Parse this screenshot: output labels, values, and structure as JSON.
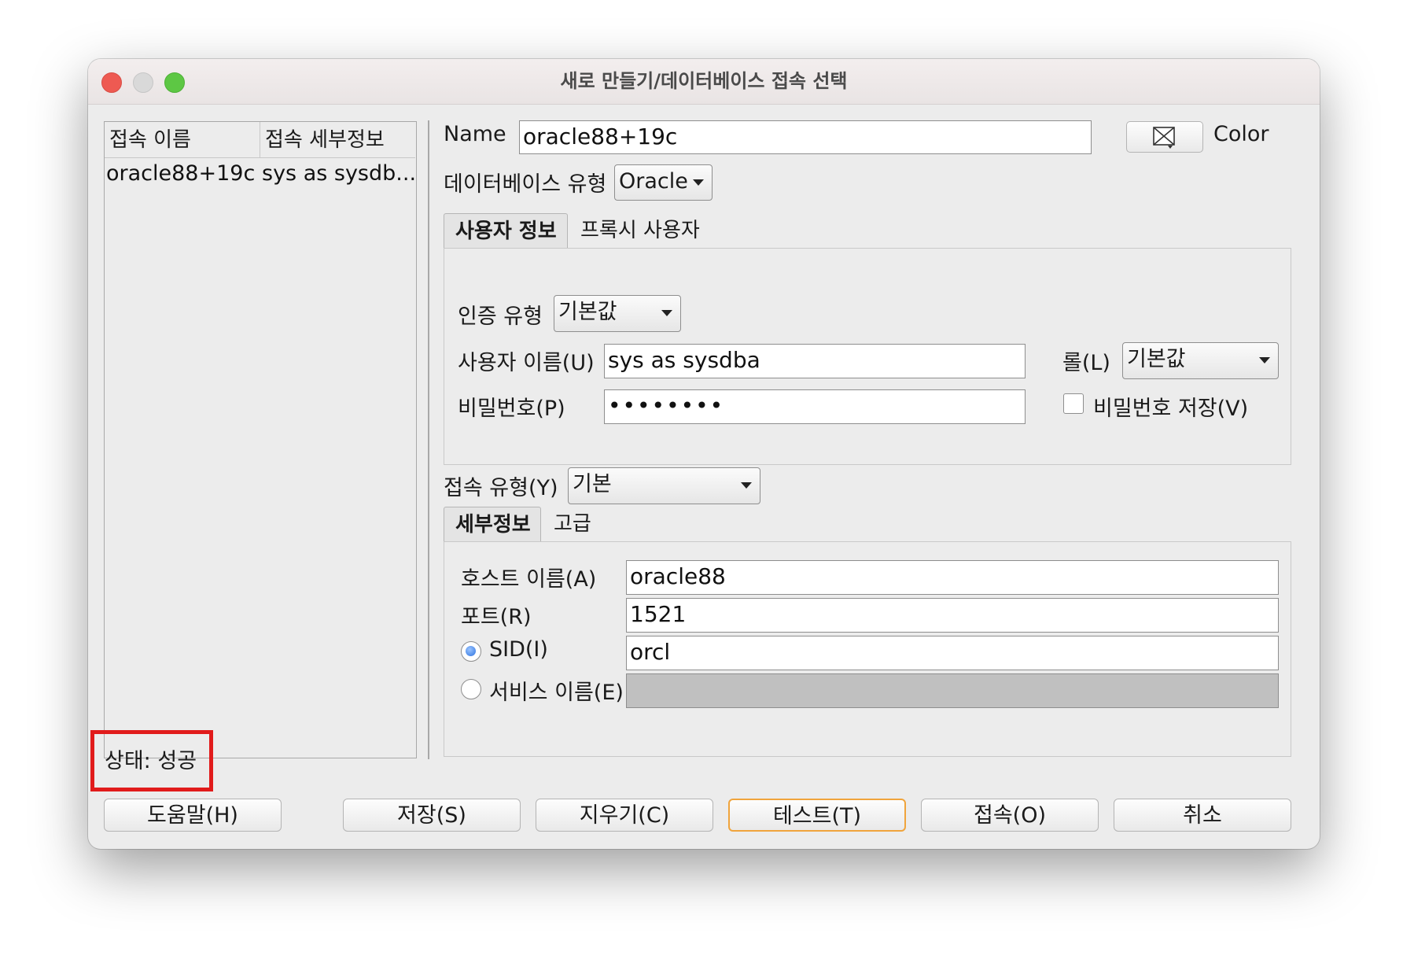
{
  "window": {
    "title": "새로 만들기/데이터베이스 접속 선택"
  },
  "connections": {
    "headers": [
      "접속 이름",
      "접속 세부정보"
    ],
    "rows": [
      {
        "name": "oracle88+19c",
        "details": "sys as sysdb..."
      }
    ]
  },
  "form": {
    "name_label": "Name",
    "name_value": "oracle88+19c",
    "color_label": "Color",
    "db_type_label": "데이터베이스 유형",
    "db_type_value": "Oracle"
  },
  "user_tabs": [
    "사용자 정보",
    "프록시 사용자"
  ],
  "user_info": {
    "auth_label": "인증 유형",
    "auth_value": "기본값",
    "username_label": "사용자 이름(U)",
    "username_value": "sys as sysdba",
    "role_label": "롤(L)",
    "role_value": "기본값",
    "password_label": "비밀번호(P)",
    "password_value": "••••••••",
    "save_password_label": "비밀번호 저장(V)",
    "save_password_checked": false
  },
  "connection_type": {
    "label": "접속 유형(Y)",
    "value": "기본"
  },
  "detail_tabs": [
    "세부정보",
    "고급"
  ],
  "details": {
    "host_label": "호스트 이름(A)",
    "host_value": "oracle88",
    "port_label": "포트(R)",
    "port_value": "1521",
    "sid_label": "SID(I)",
    "sid_value": "orcl",
    "sid_selected": true,
    "service_label": "서비스 이름(E)",
    "service_value": ""
  },
  "status": {
    "text": "상태: 성공",
    "highlight_color": "#e11b1b"
  },
  "buttons": {
    "help": "도움말(H)",
    "save": "저장(S)",
    "clear": "지우기(C)",
    "test": "테스트(T)",
    "connect": "접속(O)",
    "cancel": "취소"
  },
  "colors": {
    "default_button_border": "#f0a43c",
    "close": "#ee5a52",
    "maximize": "#5dc744"
  }
}
